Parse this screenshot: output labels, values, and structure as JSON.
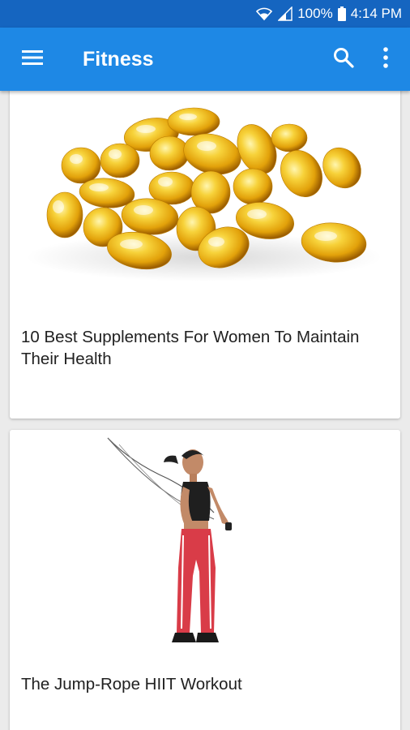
{
  "status_bar": {
    "battery_percent": "100%",
    "time": "4:14 PM",
    "icons": [
      "wifi-icon",
      "signal-icon",
      "battery-icon"
    ]
  },
  "app_bar": {
    "title": "Fitness",
    "icons": [
      "hamburger-menu-icon",
      "search-icon",
      "more-vert-icon"
    ],
    "color": "#1e88e5",
    "status_color": "#1565c0"
  },
  "feed": {
    "articles": [
      {
        "title": "10 Best Supplements For Women To Maintain Their Health",
        "image": "supplement-capsules-image"
      },
      {
        "title": "The Jump-Rope HIIT Workout",
        "image": "jump-rope-woman-image"
      }
    ]
  }
}
